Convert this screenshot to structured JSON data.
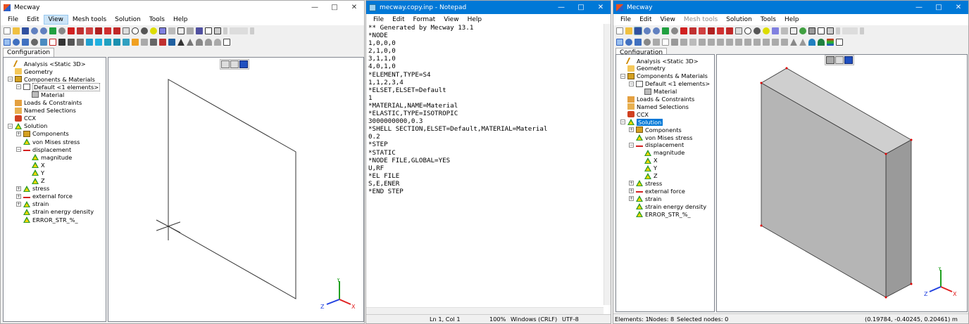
{
  "left_window": {
    "title": "Mecway",
    "menu": [
      "File",
      "Edit",
      "View",
      "Mesh tools",
      "Solution",
      "Tools",
      "Help"
    ],
    "active_menu": "View",
    "tab": "Configuration",
    "tree": [
      {
        "label": "Analysis <Static 3D>",
        "icon": "analysis-icon",
        "level": 0,
        "exp": ""
      },
      {
        "label": "Geometry",
        "icon": "geometry-folder-icon",
        "level": 0,
        "exp": ""
      },
      {
        "label": "Components & Materials",
        "icon": "components-icon",
        "level": 0,
        "exp": "-"
      },
      {
        "label": "Default <1 elements>",
        "icon": "default-element-icon",
        "level": 1,
        "exp": "-",
        "box": true
      },
      {
        "label": "Material",
        "icon": "material-icon",
        "level": 2,
        "exp": ""
      },
      {
        "label": "Loads & Constraints",
        "icon": "loads-icon",
        "level": 0,
        "exp": ""
      },
      {
        "label": "Named Selections",
        "icon": "named-selection-icon",
        "level": 0,
        "exp": ""
      },
      {
        "label": "CCX",
        "icon": "ccx-icon",
        "level": 0,
        "exp": ""
      },
      {
        "label": "Solution",
        "icon": "solution-icon",
        "level": 0,
        "exp": "-"
      },
      {
        "label": "Components",
        "icon": "components-icon",
        "level": 1,
        "exp": "+"
      },
      {
        "label": "von Mises stress",
        "icon": "result-icon",
        "level": 1,
        "exp": ""
      },
      {
        "label": "displacement",
        "icon": "displacement-icon",
        "level": 1,
        "exp": "-"
      },
      {
        "label": "magnitude",
        "icon": "result-icon",
        "level": 2,
        "exp": ""
      },
      {
        "label": "X",
        "icon": "result-icon",
        "level": 2,
        "exp": ""
      },
      {
        "label": "Y",
        "icon": "result-icon",
        "level": 2,
        "exp": ""
      },
      {
        "label": "Z",
        "icon": "result-icon",
        "level": 2,
        "exp": ""
      },
      {
        "label": "stress",
        "icon": "result-icon",
        "level": 1,
        "exp": "+"
      },
      {
        "label": "external force",
        "icon": "force-icon",
        "level": 1,
        "exp": "+"
      },
      {
        "label": "strain",
        "icon": "result-icon",
        "level": 1,
        "exp": "+"
      },
      {
        "label": "strain energy density",
        "icon": "result-icon",
        "level": 1,
        "exp": ""
      },
      {
        "label": "ERROR_STR_%_",
        "icon": "result-icon",
        "level": 1,
        "exp": ""
      }
    ],
    "axes": {
      "x": "X",
      "y": "Y",
      "z": "Z"
    }
  },
  "notepad": {
    "title": "mecway.copy.inp - Notepad",
    "menu": [
      "File",
      "Edit",
      "Format",
      "View",
      "Help"
    ],
    "lines": [
      "** Generated by Mecway 13.1",
      "*NODE",
      "1,0,0,0",
      "2,1,0,0",
      "3,1,1,0",
      "4,0,1,0",
      "*ELEMENT,TYPE=S4",
      "1,1,2,3,4",
      "*ELSET,ELSET=Default",
      "1",
      "*MATERIAL,NAME=Material",
      "*ELASTIC,TYPE=ISOTROPIC",
      "3000000000,0.3",
      "*SHELL SECTION,ELSET=Default,MATERIAL=Material",
      "0.2",
      "*STEP",
      "*STATIC",
      "*NODE FILE,GLOBAL=YES",
      "U,RF",
      "*EL FILE",
      "S,E,ENER",
      "*END STEP"
    ],
    "status": {
      "position": "Ln 1, Col 1",
      "zoom": "100%",
      "line_ending": "Windows (CRLF)",
      "encoding": "UTF-8"
    }
  },
  "right_window": {
    "title": "Mecway",
    "menu": [
      "File",
      "Edit",
      "View",
      "Mesh tools",
      "Solution",
      "Tools",
      "Help"
    ],
    "tab": "Configuration",
    "tree": [
      {
        "label": "Analysis <Static 3D>",
        "icon": "analysis-icon",
        "level": 0,
        "exp": ""
      },
      {
        "label": "Geometry",
        "icon": "geometry-folder-icon",
        "level": 0,
        "exp": ""
      },
      {
        "label": "Components & Materials",
        "icon": "components-icon",
        "level": 0,
        "exp": "-"
      },
      {
        "label": "Default <1 elements>",
        "icon": "default-element-icon",
        "level": 1,
        "exp": "-"
      },
      {
        "label": "Material",
        "icon": "material-icon",
        "level": 2,
        "exp": ""
      },
      {
        "label": "Loads & Constraints",
        "icon": "loads-icon",
        "level": 0,
        "exp": ""
      },
      {
        "label": "Named Selections",
        "icon": "named-selection-icon",
        "level": 0,
        "exp": ""
      },
      {
        "label": "CCX",
        "icon": "ccx-icon",
        "level": 0,
        "exp": ""
      },
      {
        "label": "Solution",
        "icon": "solution-icon",
        "level": 0,
        "exp": "-",
        "selected": true
      },
      {
        "label": "Components",
        "icon": "components-icon",
        "level": 1,
        "exp": "+"
      },
      {
        "label": "von Mises stress",
        "icon": "result-icon",
        "level": 1,
        "exp": ""
      },
      {
        "label": "displacement",
        "icon": "displacement-icon",
        "level": 1,
        "exp": "-"
      },
      {
        "label": "magnitude",
        "icon": "result-icon",
        "level": 2,
        "exp": ""
      },
      {
        "label": "X",
        "icon": "result-icon",
        "level": 2,
        "exp": ""
      },
      {
        "label": "Y",
        "icon": "result-icon",
        "level": 2,
        "exp": ""
      },
      {
        "label": "Z",
        "icon": "result-icon",
        "level": 2,
        "exp": ""
      },
      {
        "label": "stress",
        "icon": "result-icon",
        "level": 1,
        "exp": "+"
      },
      {
        "label": "external force",
        "icon": "force-icon",
        "level": 1,
        "exp": "+"
      },
      {
        "label": "strain",
        "icon": "result-icon",
        "level": 1,
        "exp": "+"
      },
      {
        "label": "strain energy density",
        "icon": "result-icon",
        "level": 1,
        "exp": ""
      },
      {
        "label": "ERROR_STR_%_",
        "icon": "result-icon",
        "level": 1,
        "exp": ""
      }
    ],
    "axes": {
      "x": "X",
      "y": "Y",
      "z": "Z"
    },
    "status": {
      "elements": "Elements: 1",
      "nodes": "Nodes: 8",
      "selected": "Selected nodes: 0",
      "coords": "(0.19784, -0.40245, 0.20461) m"
    }
  },
  "colors": {
    "accent": "#0078d7",
    "shell_face": "#b5b5b5",
    "node_marker": "#e00000"
  }
}
